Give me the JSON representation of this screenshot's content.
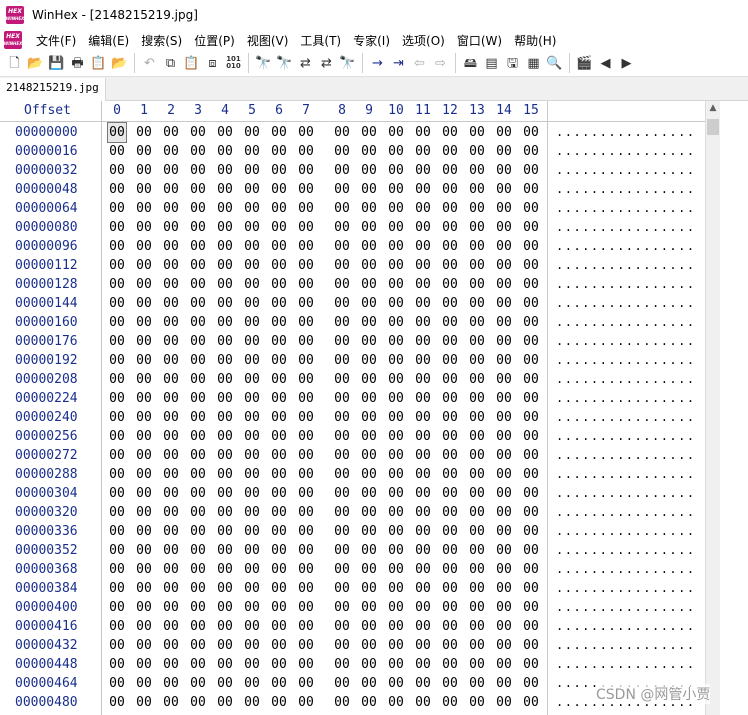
{
  "window": {
    "title": "WinHex - [2148215219.jpg]",
    "logo_top": "HEX",
    "logo_bottom": "WINHEX"
  },
  "menu": [
    "文件(F)",
    "编辑(E)",
    "搜索(S)",
    "位置(P)",
    "视图(V)",
    "工具(T)",
    "专家(I)",
    "选项(O)",
    "窗口(W)",
    "帮助(H)"
  ],
  "toolbar": {
    "groups": [
      [
        {
          "name": "new-file-icon",
          "g": "🗋"
        },
        {
          "name": "open-folder-icon",
          "g": "📂"
        },
        {
          "name": "save-icon",
          "g": "💾"
        },
        {
          "name": "print-icon",
          "g": "🖶"
        },
        {
          "name": "properties-icon",
          "g": "📋"
        },
        {
          "name": "open-disk-icon",
          "g": "📂"
        }
      ],
      [
        {
          "name": "undo-icon",
          "g": "↶",
          "dis": true
        },
        {
          "name": "copy-icon",
          "g": "⧉"
        },
        {
          "name": "paste-icon",
          "g": "📋"
        },
        {
          "name": "paste-write-icon",
          "g": "⧈"
        },
        {
          "name": "binary-icon",
          "g": "101\n010",
          "sm": true
        }
      ],
      [
        {
          "name": "find-text-icon",
          "g": "🔭"
        },
        {
          "name": "find-hex-icon",
          "g": "🔭"
        },
        {
          "name": "replace-text-icon",
          "g": "⇄"
        },
        {
          "name": "replace-hex-icon",
          "g": "⇄"
        },
        {
          "name": "find-again-icon",
          "g": "🔭"
        }
      ],
      [
        {
          "name": "goto-offset-icon",
          "g": "→",
          "blue": true
        },
        {
          "name": "goto-page-icon",
          "g": "⇥",
          "blue": true
        },
        {
          "name": "back-icon",
          "g": "⇦",
          "dis": true
        },
        {
          "name": "forward-icon",
          "g": "⇨",
          "dis": true
        }
      ],
      [
        {
          "name": "open-drive-icon",
          "g": "🖴"
        },
        {
          "name": "ram-editor-icon",
          "g": "▤"
        },
        {
          "name": "disk-tools-icon",
          "g": "🖫"
        },
        {
          "name": "calculator-icon",
          "g": "▦"
        },
        {
          "name": "search-icon",
          "g": "🔍"
        }
      ],
      [
        {
          "name": "gallery-icon",
          "g": "🎬"
        },
        {
          "name": "prev-icon",
          "g": "◀"
        },
        {
          "name": "next-icon",
          "g": "▶"
        }
      ]
    ]
  },
  "tab": {
    "label": "2148215219.jpg"
  },
  "hex": {
    "offset_label": "Offset",
    "columns": [
      "0",
      "1",
      "2",
      "3",
      "4",
      "5",
      "6",
      "7",
      "8",
      "9",
      "10",
      "11",
      "12",
      "13",
      "14",
      "15"
    ],
    "byte": "00",
    "ascii": "................",
    "offsets": [
      "00000000",
      "00000016",
      "00000032",
      "00000048",
      "00000064",
      "00000080",
      "00000096",
      "00000112",
      "00000128",
      "00000144",
      "00000160",
      "00000176",
      "00000192",
      "00000208",
      "00000224",
      "00000240",
      "00000256",
      "00000272",
      "00000288",
      "00000304",
      "00000320",
      "00000336",
      "00000352",
      "00000368",
      "00000384",
      "00000400",
      "00000416",
      "00000432",
      "00000448",
      "00000464",
      "00000480"
    ]
  },
  "scrollbar": {
    "up_arrow": "▲"
  },
  "watermark": "CSDN @网管小贾",
  "colors": {
    "offset_blue": "#1a2f8c",
    "logo_magenta": "#c2187a"
  }
}
